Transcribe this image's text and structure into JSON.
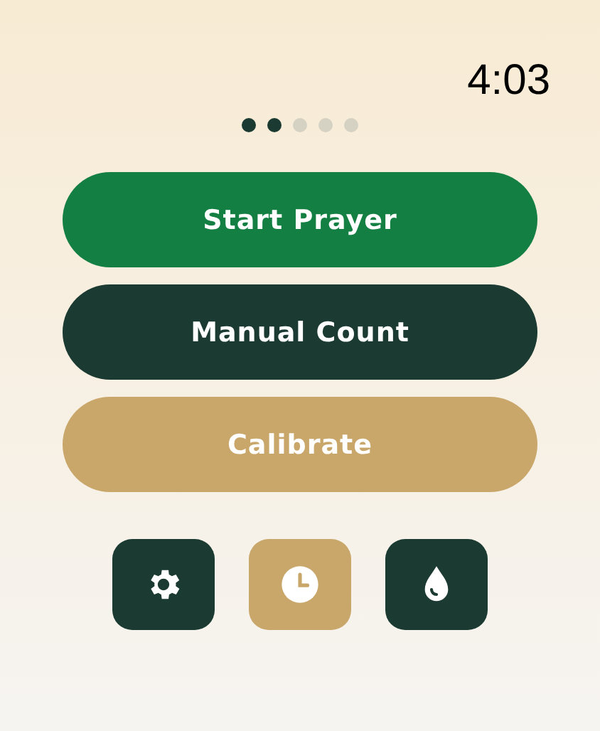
{
  "status_bar": {
    "time": "4:03"
  },
  "page_dots": [
    {
      "active": true
    },
    {
      "active": true
    },
    {
      "active": false
    },
    {
      "active": false
    },
    {
      "active": false
    }
  ],
  "actions": [
    {
      "label": "Start Prayer",
      "kind": "primary"
    },
    {
      "label": "Manual Count",
      "kind": "dark"
    },
    {
      "label": "Calibrate",
      "kind": "tan"
    }
  ],
  "shortcuts": [
    {
      "kind": "settings",
      "selected": false
    },
    {
      "kind": "history",
      "selected": true
    },
    {
      "kind": "drop",
      "selected": false
    }
  ]
}
